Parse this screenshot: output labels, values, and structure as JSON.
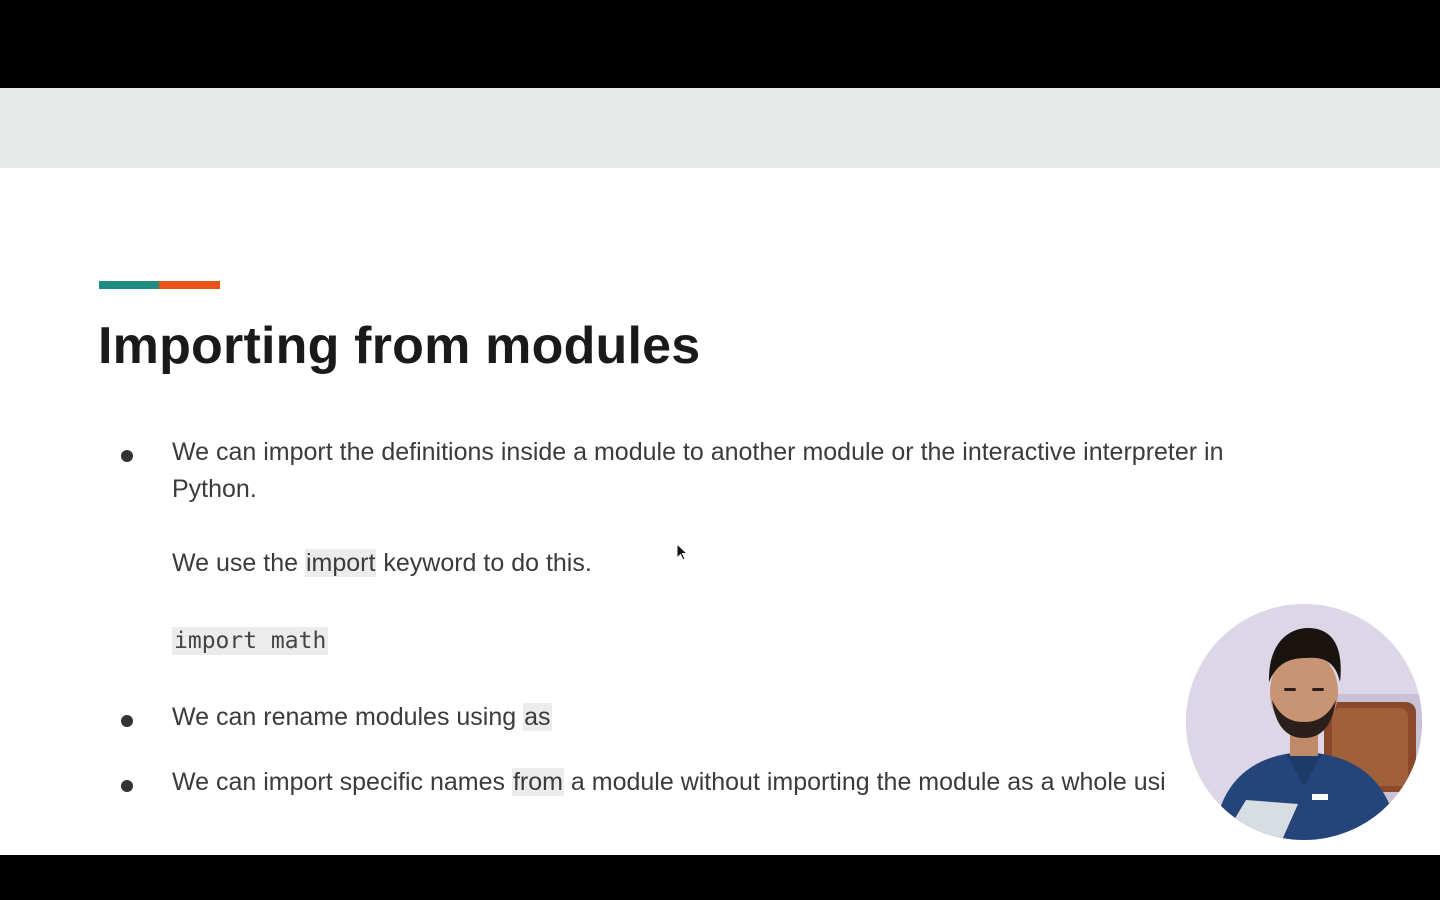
{
  "slide": {
    "title": "Importing from modules",
    "accent_colors": {
      "left": "#1e8c80",
      "right": "#e8531a"
    },
    "bullets": [
      {
        "lines": [
          "We can import the definitions inside a module to another module or the interactive interpreter in",
          "Python."
        ],
        "sub": {
          "pre": "We use the ",
          "keyword": "import",
          "post": " keyword to do this."
        },
        "code": "import math"
      },
      {
        "pre": "We can rename modules using ",
        "keyword": "as",
        "post": ""
      },
      {
        "pre": "We can import specific names ",
        "keyword": "from",
        "post": " a module without importing the module as a whole usi"
      }
    ]
  },
  "icons": {
    "cursor": "mouse-pointer-icon",
    "webcam": "presenter-webcam"
  }
}
